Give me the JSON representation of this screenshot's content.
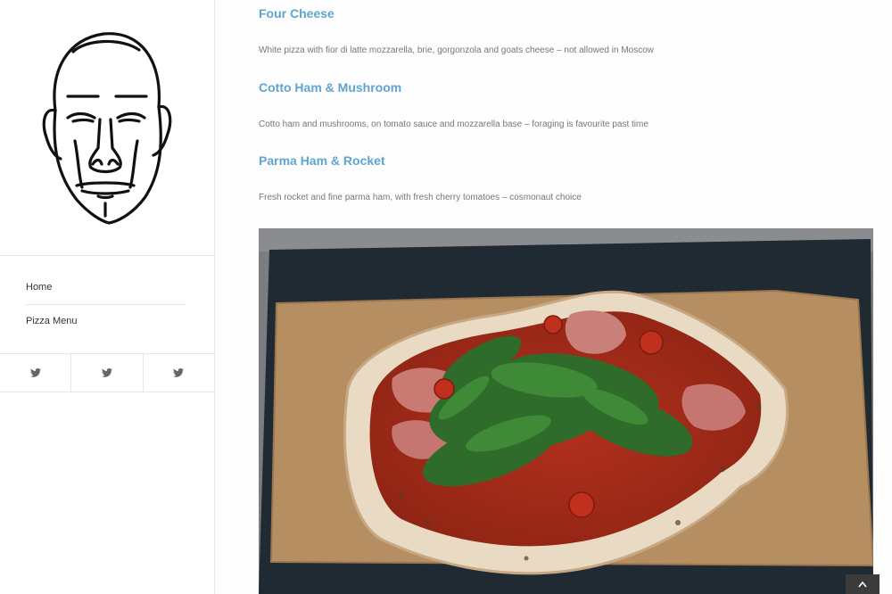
{
  "nav": {
    "items": [
      {
        "label": "Home"
      },
      {
        "label": "Pizza Menu"
      }
    ]
  },
  "social": {
    "icons": [
      "twitter-icon",
      "twitter-icon",
      "twitter-icon"
    ]
  },
  "menu": {
    "items": [
      {
        "title": "Four Cheese",
        "description": "White pizza with fior di latte mozzarella, brie, gorgonzola and goats cheese – not allowed in Moscow"
      },
      {
        "title": "Cotto Ham & Mushroom",
        "description": "Cotto ham and mushrooms, on tomato sauce and mozzarella base – foraging is favourite past time"
      },
      {
        "title": "Parma Ham & Rocket",
        "description": "Fresh rocket and fine parma ham, with fresh cherry tomatoes – cosmonaut choice"
      }
    ]
  },
  "colors": {
    "accent": "#5ea6cf",
    "sidebar_bg": "#ffffff",
    "divider": "#e6e6e6"
  },
  "scroll_top": {
    "icon": "chevron-up-icon"
  }
}
